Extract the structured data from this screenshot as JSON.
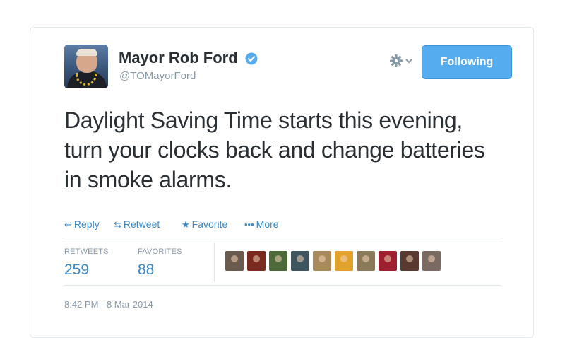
{
  "user": {
    "display_name": "Mayor Rob Ford",
    "handle": "@TOMayorFord"
  },
  "header": {
    "follow_label": "Following",
    "settings_icon": "gear-icon",
    "verified_icon": "verified-badge-icon"
  },
  "tweet": {
    "text": "Daylight Saving Time starts this evening, turn your clocks back and change batteries in smoke alarms."
  },
  "actions": [
    {
      "label": "Reply",
      "icon": "reply-icon"
    },
    {
      "label": "Retweet",
      "icon": "retweet-icon"
    },
    {
      "label": "Favorite",
      "icon": "star-icon"
    },
    {
      "label": "More",
      "icon": "ellipsis-icon"
    }
  ],
  "stats": {
    "retweets_label": "RETWEETS",
    "retweets_value": "259",
    "favorites_label": "FAVORITES",
    "favorites_value": "88"
  },
  "favoriters_count_shown": 10,
  "timestamp": "8:42 PM - 8 Mar 2014",
  "colors": {
    "accent": "#55acee",
    "link": "#3b88c3",
    "muted": "#8899a6",
    "text": "#292f33",
    "border": "#e1e8ed"
  }
}
